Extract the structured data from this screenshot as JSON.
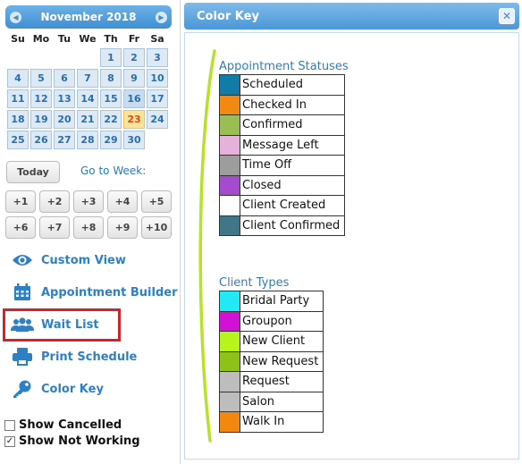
{
  "calendar": {
    "month_label": "November 2018",
    "prev_icon": "chevron-left-icon",
    "next_icon": "chevron-right-icon",
    "weekdays": [
      "Su",
      "Mo",
      "Tu",
      "We",
      "Th",
      "Fr",
      "Sa"
    ],
    "leading_blanks": 4,
    "days": [
      "1",
      "2",
      "3",
      "4",
      "5",
      "6",
      "7",
      "8",
      "9",
      "10",
      "11",
      "12",
      "13",
      "14",
      "15",
      "16",
      "17",
      "18",
      "19",
      "20",
      "21",
      "22",
      "23",
      "24",
      "25",
      "26",
      "27",
      "28",
      "29",
      "30"
    ],
    "today": "23",
    "selected_week": [
      "16",
      "23"
    ]
  },
  "controls": {
    "today_label": "Today",
    "goto_week_label": "Go to Week:",
    "week_buttons": [
      "+1",
      "+2",
      "+3",
      "+4",
      "+5",
      "+6",
      "+7",
      "+8",
      "+9",
      "+10"
    ]
  },
  "sidebar_links": [
    {
      "id": "custom-view",
      "label": "Custom View",
      "icon": "eye-icon"
    },
    {
      "id": "appointment-builder",
      "label": "Appointment Builder",
      "icon": "calendar-icon"
    },
    {
      "id": "wait-list",
      "label": "Wait List",
      "icon": "users-icon"
    },
    {
      "id": "print-schedule",
      "label": "Print Schedule",
      "icon": "printer-icon"
    },
    {
      "id": "color-key",
      "label": "Color Key",
      "icon": "key-icon"
    }
  ],
  "checkboxes": [
    {
      "id": "show-cancelled",
      "label": "Show Cancelled",
      "checked": false
    },
    {
      "id": "show-not-working",
      "label": "Show Not Working",
      "checked": true
    }
  ],
  "panel": {
    "title": "Color Key",
    "close_icon": "close-icon",
    "appointment_statuses_title": "Appointment Statuses",
    "appointment_statuses": [
      {
        "name": "Scheduled",
        "color": "#117ca8"
      },
      {
        "name": "Checked In",
        "color": "#f28a12"
      },
      {
        "name": "Confirmed",
        "color": "#9abe52"
      },
      {
        "name": "Message Left",
        "color": "#e6b2dc"
      },
      {
        "name": "Time Off",
        "color": "#9d9d9d"
      },
      {
        "name": "Closed",
        "color": "#a64ad0"
      },
      {
        "name": "Client Created",
        "color": "#ffffff"
      },
      {
        "name": "Client Confirmed",
        "color": "#3f7688"
      }
    ],
    "client_types_title": "Client Types",
    "client_types": [
      {
        "name": "Bridal Party",
        "color": "#22e9f5"
      },
      {
        "name": "Groupon",
        "color": "#d311d6"
      },
      {
        "name": "New Client",
        "color": "#b6f41c"
      },
      {
        "name": "New Request",
        "color": "#8ec217"
      },
      {
        "name": "Request",
        "color": "#bdbdbd"
      },
      {
        "name": "Salon",
        "color": "#bdbdbd"
      },
      {
        "name": "Walk In",
        "color": "#f2880f"
      }
    ]
  },
  "colors": {
    "link": "#2e80c6",
    "header_blue": "#4b97d6",
    "highlight_red": "#d3232a",
    "brace_green": "#b9e02a"
  }
}
